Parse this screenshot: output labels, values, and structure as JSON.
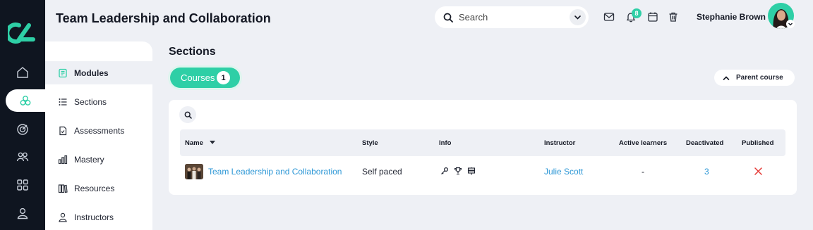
{
  "header": {
    "title": "Team Leadership and Collaboration",
    "search_placeholder": "Search",
    "notification_count": "8",
    "user_name": "Stephanie Brown"
  },
  "rail": {
    "items": [
      "home-icon",
      "modules-icon",
      "target-icon",
      "users-icon",
      "grid-icon",
      "person-icon"
    ]
  },
  "subnav": {
    "items": [
      {
        "label": "Modules",
        "icon": "book-icon",
        "active": true
      },
      {
        "label": "Sections",
        "icon": "list-icon"
      },
      {
        "label": "Assessments",
        "icon": "document-check-icon"
      },
      {
        "label": "Mastery",
        "icon": "bar-chart-icon"
      },
      {
        "label": "Resources",
        "icon": "books-icon"
      },
      {
        "label": "Instructors",
        "icon": "instructor-icon"
      }
    ]
  },
  "main": {
    "title": "Sections",
    "courses_tab": {
      "label": "Courses",
      "count": "1"
    },
    "parent_course_label": "Parent course"
  },
  "table": {
    "columns": [
      "Name",
      "Style",
      "Info",
      "Instructor",
      "Active learners",
      "Deactivated",
      "Published"
    ],
    "rows": [
      {
        "name": "Team Leadership and Collaboration",
        "style": "Self paced",
        "info_icons": [
          "key-icon",
          "trophy-icon",
          "sign-icon"
        ],
        "instructor": "Julie Scott",
        "active_learners": "-",
        "deactivated": "3",
        "published": "x"
      }
    ]
  },
  "colors": {
    "accent": "#2ecfa6",
    "rail": "#0f1520",
    "link": "#2c97d6",
    "unpublished": "#e53935"
  }
}
